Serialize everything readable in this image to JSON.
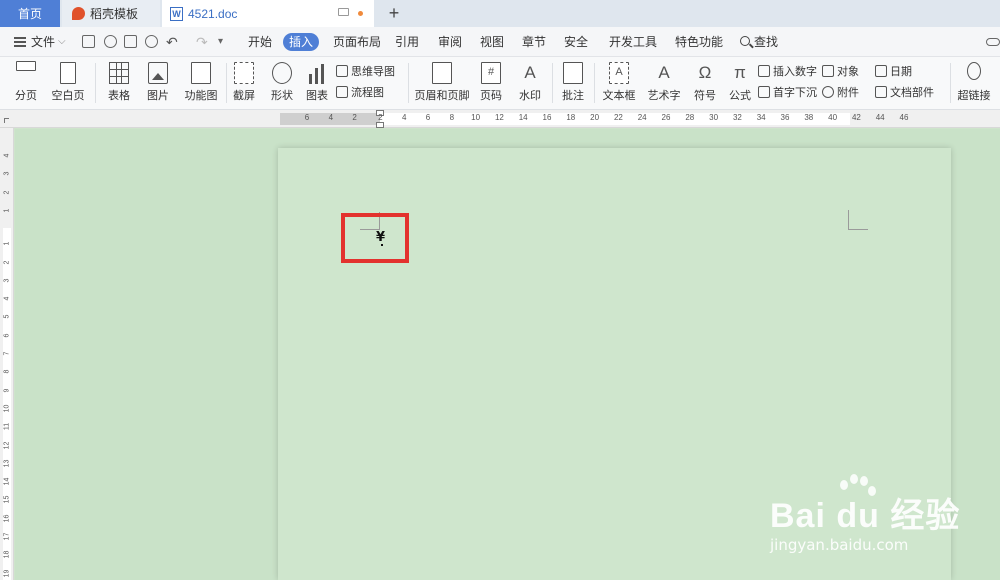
{
  "tabs": {
    "home": "首页",
    "template": "稻壳模板",
    "document": "4521.doc",
    "new_tab": "+"
  },
  "menu": {
    "file": "文件",
    "items": [
      "开始",
      "插入",
      "页面布局",
      "引用",
      "审阅",
      "视图",
      "章节",
      "安全",
      "开发工具",
      "特色功能"
    ],
    "active": "插入",
    "search": "查找"
  },
  "ribbon": {
    "page_break": "分页",
    "blank_page": "空白页",
    "table": "表格",
    "picture": "图片",
    "function_chart": "功能图",
    "screenshot": "截屏",
    "shape": "形状",
    "chart": "图表",
    "mind_map": "思维导图",
    "flowchart": "流程图",
    "header_footer": "页眉和页脚",
    "page_number": "页码",
    "watermark": "水印",
    "comment": "批注",
    "text_box": "文本框",
    "word_art": "艺术字",
    "symbol": "符号",
    "formula": "公式",
    "insert_number": "插入数字",
    "drop_cap": "首字下沉",
    "object": "对象",
    "attachment": "附件",
    "date": "日期",
    "doc_parts": "文档部件",
    "hyperlink": "超链接"
  },
  "ruler": {
    "h_ticks": [
      "6",
      "4",
      "2",
      "2",
      "4",
      "6",
      "8",
      "10",
      "12",
      "14",
      "16",
      "18",
      "20",
      "22",
      "24",
      "26",
      "28",
      "30",
      "32",
      "34",
      "36",
      "38",
      "40",
      "42",
      "44",
      "46"
    ],
    "v_ticks": [
      "4",
      "3",
      "2",
      "1",
      "1",
      "2",
      "3",
      "4",
      "5",
      "6",
      "7",
      "8",
      "9",
      "10",
      "11",
      "12",
      "13",
      "14",
      "15",
      "16",
      "17",
      "18",
      "19"
    ]
  },
  "document": {
    "inserted_symbol": "¥"
  },
  "watermark": {
    "brand": "Bai du 经验",
    "url": "jingyan.baidu.com"
  },
  "colors": {
    "accent": "#4f7fd6",
    "highlight": "#e3322e",
    "page_bg": "#cfe6cd"
  }
}
